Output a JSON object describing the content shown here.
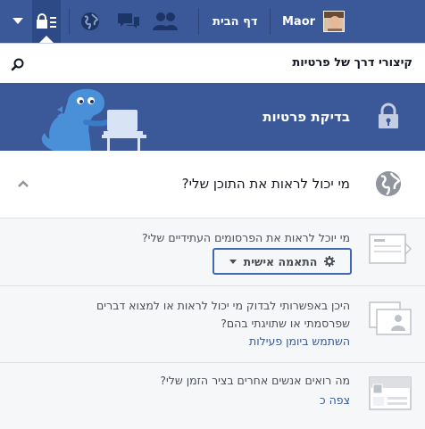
{
  "topbar": {
    "home_label": "דף הבית",
    "profile_name": "Maor"
  },
  "shortcuts": {
    "title": "קיצורי דרך של פרטיות"
  },
  "checkup": {
    "title": "בדיקת פרטיות"
  },
  "who_can_see": {
    "title": "מי יכול לראות את התוכן שלי?"
  },
  "rows": [
    {
      "question": "מי יוכל לראות את הפרסומים העתידיים שלי?",
      "audience_label": "התאמה אישית"
    },
    {
      "question_line1": "היכן באפשרותי לבדוק מי יכול לראות או למצוא דברים",
      "question_line2": "שפרסמתי או שתויגתי בהם?",
      "link": "השתמש ביומן פעילות"
    },
    {
      "question": "מה רואים אנשים אחרים בציר הזמן שלי?",
      "link": "צפה כ"
    }
  ],
  "colors": {
    "brand": "#3b5998",
    "link": "#365899",
    "dino": "#4a90d9"
  }
}
